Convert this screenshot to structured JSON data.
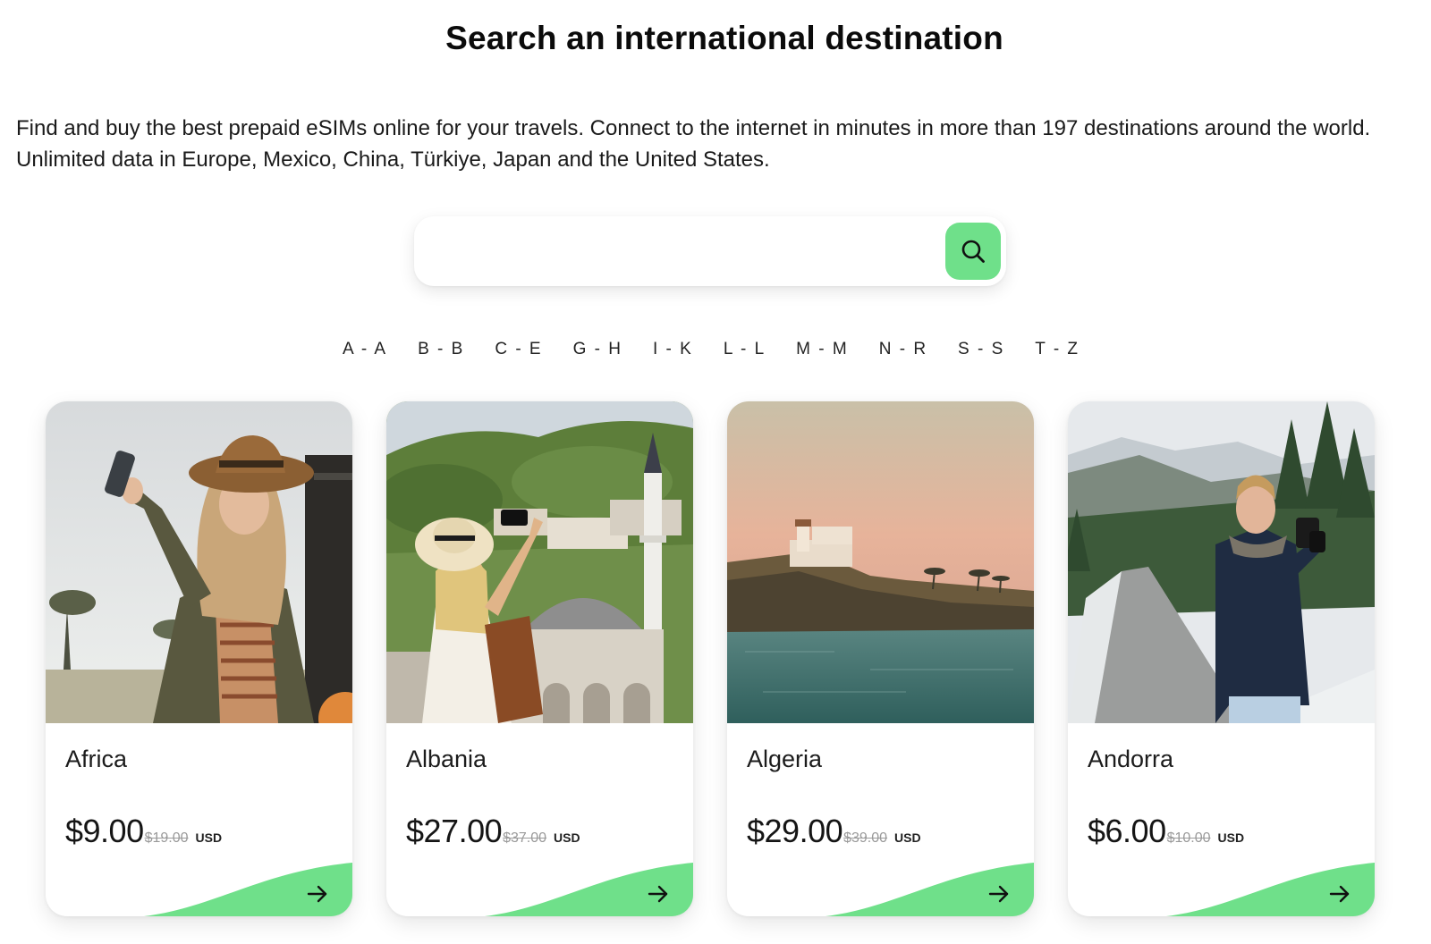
{
  "header": {
    "title": "Search an international destination",
    "intro": "Find and buy the best prepaid eSIMs online for your travels. Connect to the internet in minutes in more than 197 destinations around the world. Unlimited data in Europe, Mexico, China, Türkiye, Japan and the United States."
  },
  "search": {
    "placeholder": "",
    "value": "",
    "button_icon": "search-icon",
    "accent": "#6fe08a"
  },
  "alpha_nav": [
    "A - A",
    "B - B",
    "C - E",
    "G - H",
    "I - K",
    "L - L",
    "M - M",
    "N - R",
    "S - S",
    "T - Z"
  ],
  "cards": [
    {
      "name": "Africa",
      "price": "$9.00",
      "old_price": "$19.00",
      "currency": "USD",
      "image": "woman-in-hat-taking-selfie"
    },
    {
      "name": "Albania",
      "price": "$27.00",
      "old_price": "$37.00",
      "currency": "USD",
      "image": "woman-photographing-mosque"
    },
    {
      "name": "Algeria",
      "price": "$29.00",
      "old_price": "$39.00",
      "currency": "USD",
      "image": "coastal-lighthouse-at-dusk"
    },
    {
      "name": "Andorra",
      "price": "$6.00",
      "old_price": "$10.00",
      "currency": "USD",
      "image": "man-photographing-mountain-road"
    }
  ],
  "colors": {
    "accent_green": "#6fe08a",
    "text": "#111111",
    "muted": "#9a9a9a"
  }
}
